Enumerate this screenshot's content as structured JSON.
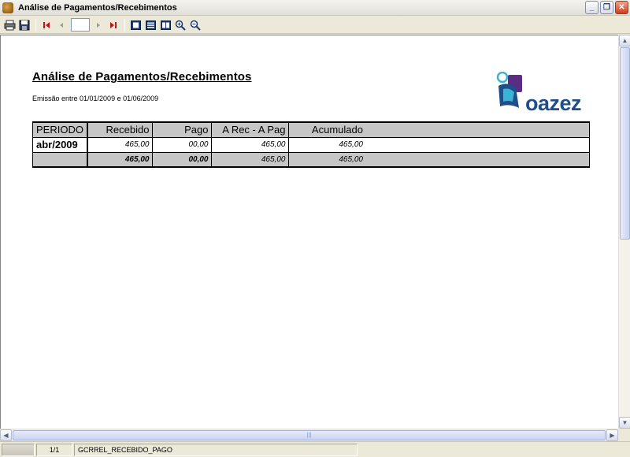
{
  "window": {
    "title": "Análise de Pagamentos/Recebimentos"
  },
  "toolbar": {
    "page_value": ""
  },
  "report": {
    "title": "Análise de Pagamentos/Recebimentos",
    "emission": "Emissão entre 01/01/2009 e 01/06/2009",
    "logo_text": "oazez",
    "columns": [
      "PERIODO",
      "Recebido",
      "Pago",
      "A Rec - A Pag",
      "Acumulado"
    ],
    "rows": [
      {
        "periodo": "abr/2009",
        "recebido": "465,00",
        "pago": "00,00",
        "arec_apag": "465,00",
        "acumulado": "465,00"
      }
    ],
    "totals": {
      "periodo": "",
      "recebido": "465,00",
      "pago": "00,00",
      "arec_apag": "465,00",
      "acumulado": "465,00"
    }
  },
  "statusbar": {
    "pages": "1/1",
    "report_name": "GCRREL_RECEBIDO_PAGO"
  },
  "colors": {
    "header_bg": "#c6c6c6",
    "logo_blue": "#1f4f8b",
    "logo_cyan": "#3ab3d6",
    "logo_purple": "#5a2d82"
  },
  "icons": [
    "app-icon",
    "print-icon",
    "save-icon",
    "first-page-icon",
    "prev-page-icon",
    "next-page-icon",
    "last-page-icon",
    "single-page-icon",
    "multi-page-icon",
    "page-width-icon",
    "zoom-in-icon",
    "zoom-out-icon"
  ]
}
